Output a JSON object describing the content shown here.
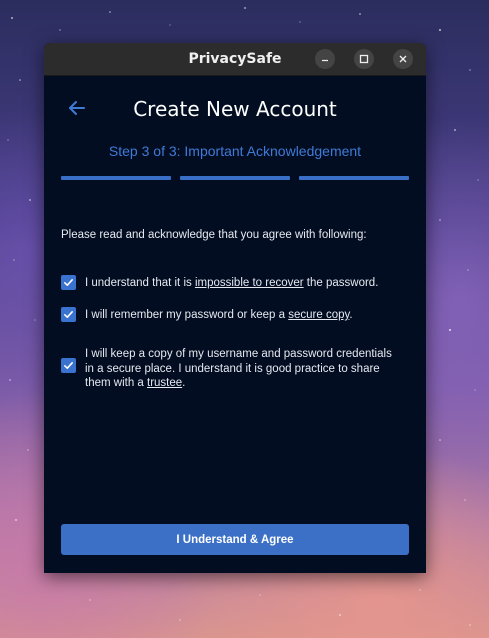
{
  "window": {
    "title": "PrivacySafe",
    "controls": [
      "minimize-icon",
      "maximize-icon",
      "close-icon"
    ]
  },
  "header": {
    "back_icon": "arrow-left-icon",
    "title": "Create New Account",
    "step_label": "Step 3 of 3: Important Acknowledgement",
    "steps_total": 3,
    "steps_completed": 3
  },
  "intro": "Please read and acknowledge that you agree with following:",
  "acknowledgements": [
    {
      "checked": true,
      "before": "I understand that it is ",
      "link": "impossible to recover",
      "after": " the password."
    },
    {
      "checked": true,
      "before": "I will remember my password or keep a ",
      "link": "secure copy",
      "after": "."
    },
    {
      "checked": true,
      "before": "I will keep a copy of my username and password credentials in a secure place. I understand it is good practice to share them with a ",
      "link": "trustee",
      "after": "."
    }
  ],
  "primary_button": "I Understand & Agree",
  "colors": {
    "window_bg": "#020d22",
    "titlebar_bg": "#2c2c2c",
    "accent": "#3c70c6",
    "step_text": "#3f7bd6"
  }
}
